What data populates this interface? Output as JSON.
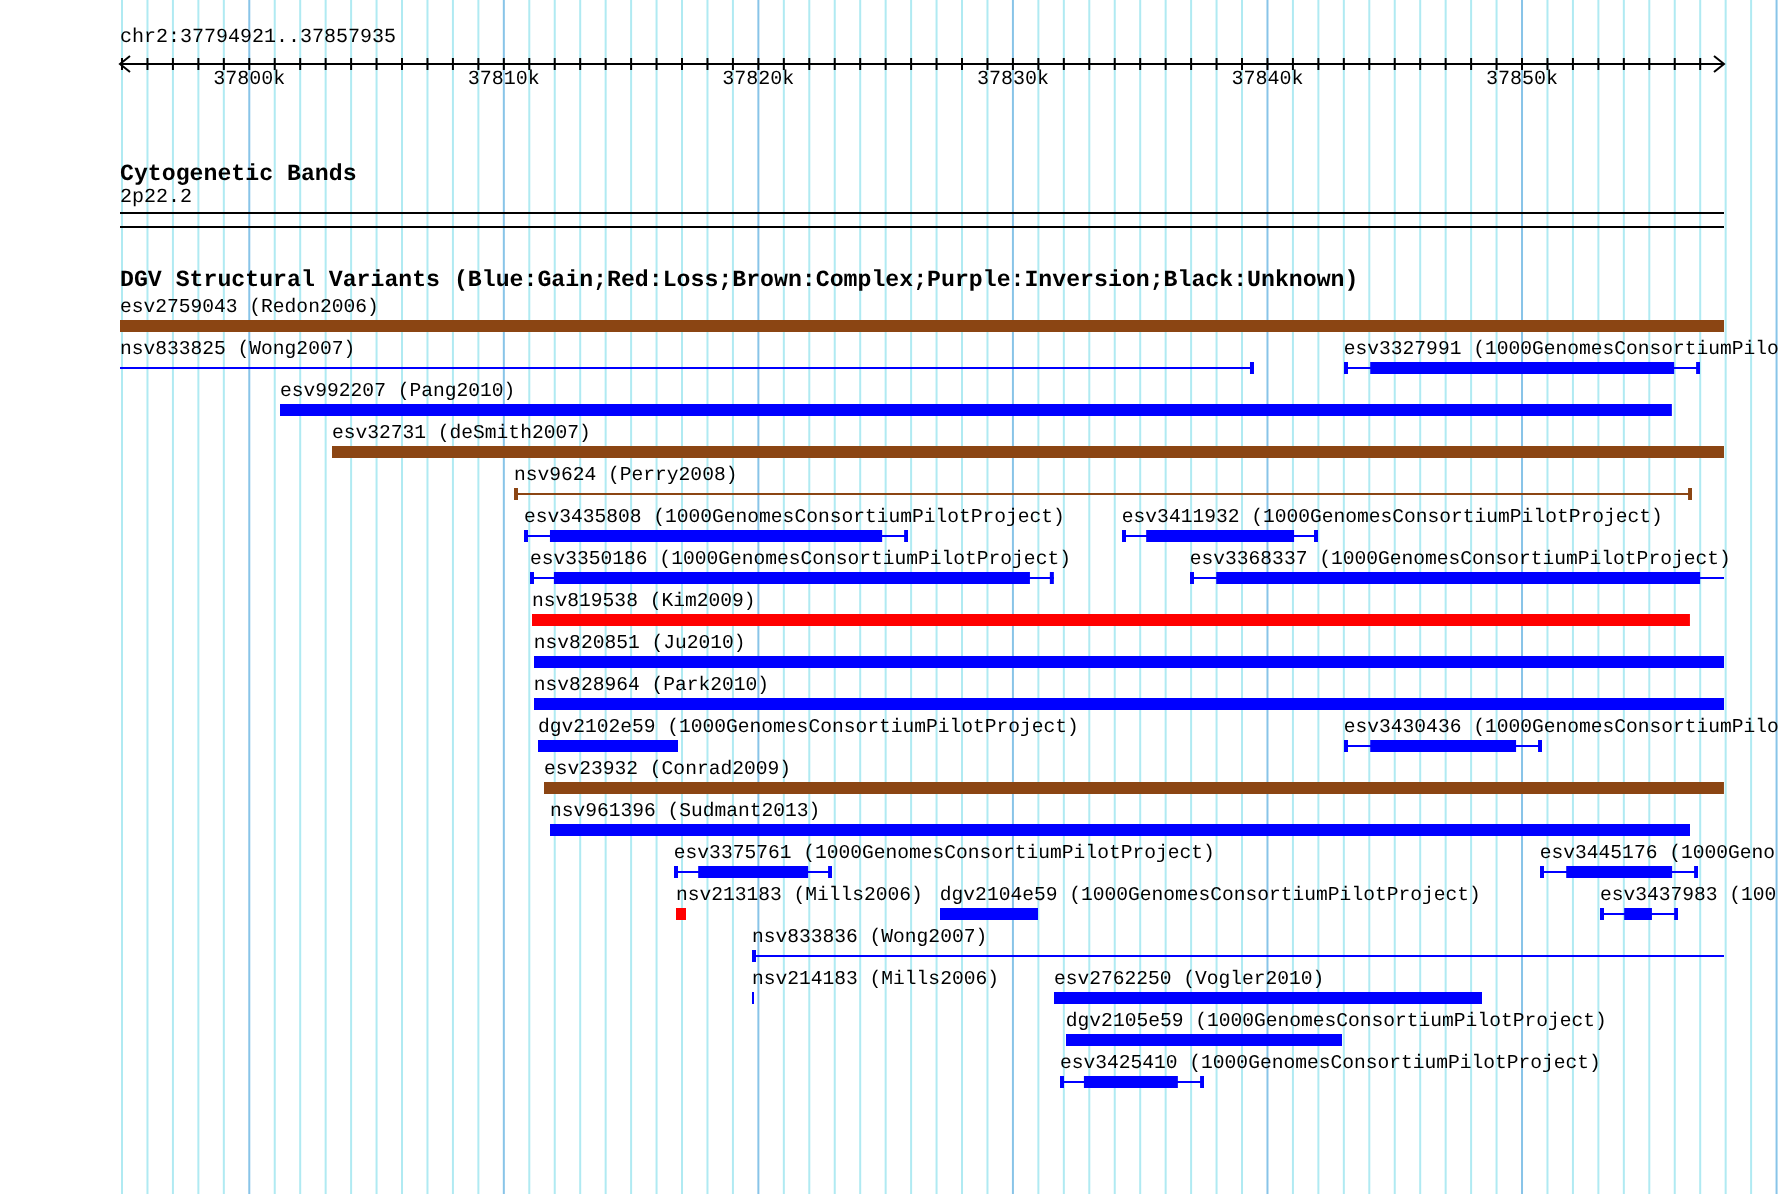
{
  "view": {
    "label": "chr2:37794921..37857935"
  },
  "axis": {
    "ticks": [
      {
        "label": "37800k"
      },
      {
        "label": "37810k"
      },
      {
        "label": "37820k"
      },
      {
        "label": "37830k"
      },
      {
        "label": "37840k"
      },
      {
        "label": "37850k"
      }
    ]
  },
  "cytoband_track": {
    "title": "Cytogenetic Bands",
    "band": "2p22.2"
  },
  "dgv_track": {
    "title": "DGV Structural Variants (Blue:Gain;Red:Loss;Brown:Complex;Purple:Inversion;Black:Unknown)",
    "rows": [
      [
        {
          "label": "esv2759043 (Redon2006)",
          "kind": "bar",
          "color": "#8b4513"
        }
      ],
      [
        {
          "label": "nsv833825 (Wong2007)",
          "kind": "line",
          "color": "#0000ff"
        },
        {
          "label": "esv3327991 (1000GenomesConsortiumPilo",
          "kind": "whisker",
          "color": "#0000ff"
        }
      ],
      [
        {
          "label": "esv992207 (Pang2010)",
          "kind": "bar",
          "color": "#0000ff"
        }
      ],
      [
        {
          "label": "esv32731 (deSmith2007)",
          "kind": "bar",
          "color": "#8b4513"
        }
      ],
      [
        {
          "label": "nsv9624 (Perry2008)",
          "kind": "line",
          "color": "#8b4513"
        }
      ],
      [
        {
          "label": "esv3435808 (1000GenomesConsortiumPilotProject)",
          "kind": "whisker",
          "color": "#0000ff"
        },
        {
          "label": "esv3411932 (1000GenomesConsortiumPilotProject)",
          "kind": "whisker",
          "color": "#0000ff"
        }
      ],
      [
        {
          "label": "esv3350186 (1000GenomesConsortiumPilotProject)",
          "kind": "whisker",
          "color": "#0000ff"
        },
        {
          "label": "esv3368337 (1000GenomesConsortiumPilotProject)",
          "kind": "whisker",
          "color": "#0000ff"
        }
      ],
      [
        {
          "label": "nsv819538 (Kim2009)",
          "kind": "bar",
          "color": "#ff0000"
        }
      ],
      [
        {
          "label": "nsv820851 (Ju2010)",
          "kind": "bar",
          "color": "#0000ff"
        }
      ],
      [
        {
          "label": "nsv828964 (Park2010)",
          "kind": "bar",
          "color": "#0000ff"
        }
      ],
      [
        {
          "label": "dgv2102e59 (1000GenomesConsortiumPilotProject)",
          "kind": "bar",
          "color": "#0000ff"
        },
        {
          "label": "esv3430436 (1000GenomesConsortiumPilo",
          "kind": "whisker",
          "color": "#0000ff"
        }
      ],
      [
        {
          "label": "esv23932 (Conrad2009)",
          "kind": "bar",
          "color": "#8b4513"
        }
      ],
      [
        {
          "label": "nsv961396 (Sudmant2013)",
          "kind": "bar",
          "color": "#0000ff"
        }
      ],
      [
        {
          "label": "esv3375761 (1000GenomesConsortiumPilotProject)",
          "kind": "whisker",
          "color": "#0000ff"
        },
        {
          "label": "esv3445176 (1000Geno",
          "kind": "whisker",
          "color": "#0000ff"
        }
      ],
      [
        {
          "label": "nsv213183 (Mills2006)",
          "kind": "bar",
          "color": "#ff0000"
        },
        {
          "label": "dgv2104e59 (1000GenomesConsortiumPilotProject)",
          "kind": "bar",
          "color": "#0000ff"
        },
        {
          "label": "esv3437983 (100",
          "kind": "whisker",
          "color": "#0000ff"
        }
      ],
      [
        {
          "label": "nsv833836 (Wong2007)",
          "kind": "line",
          "color": "#0000ff"
        }
      ],
      [
        {
          "label": "nsv214183 (Mills2006)",
          "kind": "bar",
          "color": "#0000ff"
        },
        {
          "label": "esv2762250 (Vogler2010)",
          "kind": "bar",
          "color": "#0000ff"
        }
      ],
      [
        {
          "label": "dgv2105e59 (1000GenomesConsortiumPilotProject)",
          "kind": "bar",
          "color": "#0000ff"
        }
      ],
      [
        {
          "label": "esv3425410 (1000GenomesConsortiumPilotProject)",
          "kind": "whisker",
          "color": "#0000ff"
        }
      ]
    ]
  }
}
